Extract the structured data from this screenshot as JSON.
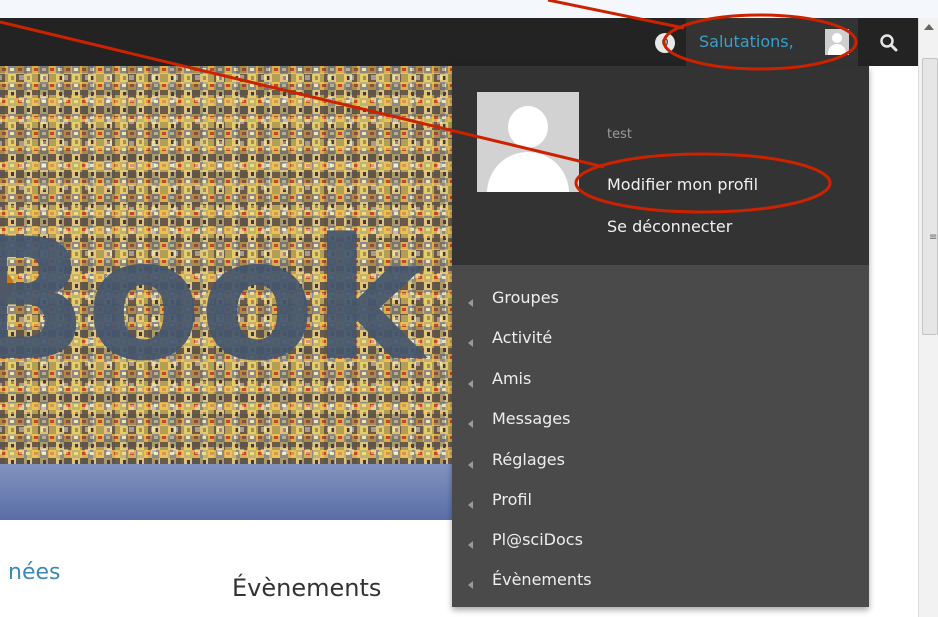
{
  "adminbar": {
    "notification_count": "0",
    "greeting": "Salutations,"
  },
  "banner": {
    "title_fragment": "Book"
  },
  "page": {
    "partial_word": "nées",
    "events_heading": "Évènements"
  },
  "account_menu": {
    "username": "test",
    "edit_profile": "Modifier mon profil",
    "logout": "Se déconnecter",
    "items": [
      {
        "label": "Groupes"
      },
      {
        "label": "Activité"
      },
      {
        "label": "Amis"
      },
      {
        "label": "Messages"
      },
      {
        "label": "Réglages"
      },
      {
        "label": "Profil"
      },
      {
        "label": "Pl@sciDocs"
      },
      {
        "label": "Évènements"
      }
    ]
  },
  "annotation": {
    "color": "#cc2200"
  },
  "icons": [
    "notification-icon",
    "avatar-icon",
    "search-icon",
    "arrow-left-icon"
  ]
}
